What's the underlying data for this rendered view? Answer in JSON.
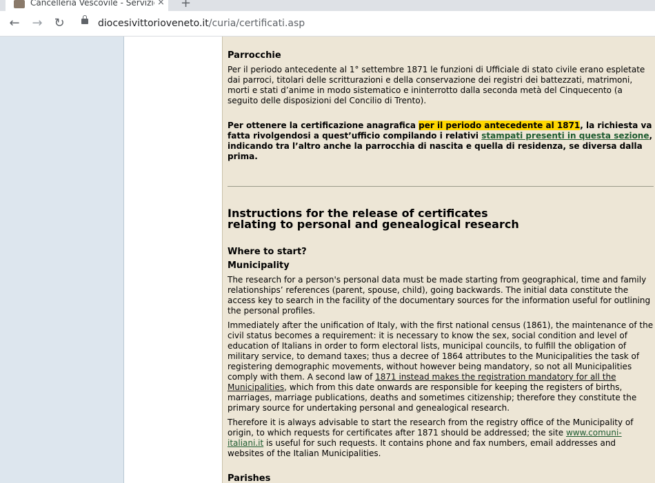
{
  "browser": {
    "tab_title": "Cancelleria Vescovile - Servizio ce",
    "tab_close": "×",
    "new_tab": "+",
    "url_domain": "diocesivittorioveneto.it",
    "url_path": "/curia/certificati.asp"
  },
  "italian": {
    "heading": "Parrocchie",
    "para1": "Per il periodo antecedente al 1° settembre 1871 le funzioni di Ufficiale di stato civile erano espletate dai parroci, titolari delle scritturazioni e della conservazione dei registri dei battezzati, matrimoni, morti e stati d’anime in modo sistematico e ininterrotto dalla seconda metà del Cinquecento (a seguito delle disposizioni del Concilio di Trento).",
    "para2_pre": "Per ottenere la certificazione anagrafica ",
    "para2_highlight": "per il periodo antecedente al 1871",
    "para2_mid": ", la richiesta va fatta rivolgendosi a quest’ufficio compilando i relativi ",
    "para2_link": "stampati presenti in questa sezione",
    "para2_post": ", indicando tra l’altro anche la parrocchia di nascita e quella di residenza, se diversa dalla prima."
  },
  "english": {
    "title_line1": "Instructions for the release of certificates",
    "title_line2": "relating to personal and genealogical research",
    "where_heading": "Where to start?",
    "municipality_heading": "Municipality",
    "para1": "The research for a person's personal data must be made starting from geographical, time and family relationships’ references (parent, spouse, child), going backwards. The initial data constitute the access key to search in the facility of the documentary sources for the information useful for outlining the personal profiles.",
    "para2_pre": "Immediately after the unification of Italy, with the first national census (1861), the maintenance of the civil status becomes a requirement: it is necessary to know the sex, social condition and level of education of Italians in order to form electoral lists, municipal councils, to fulfill the obligation of military service, to demand taxes; thus a decree of 1864 attributes to the Municipalities the task of registering demographic movements, without however being mandatory, so not all Municipalities comply with them. A second law of ",
    "para2_link": "1871 instead makes the registration mandatory for all the Municipalities",
    "para2_post": ", which from this date onwards are responsible for keeping the registers of births, marriages, marriage publications, deaths and sometimes citizenship; therefore they constitute the primary source for undertaking personal and genealogical research.",
    "para3_pre": "Therefore it is always advisable to start the research from the registry office of the Municipality of origin, to which requests for certificates after 1871 should be addressed; the site ",
    "para3_link": "www.comuni-italiani.it",
    "para3_post": " is useful for such requests. It contains phone and fax numbers, email addresses and websites of the Italian Municipalities.",
    "parishes_heading": "Parishes"
  }
}
